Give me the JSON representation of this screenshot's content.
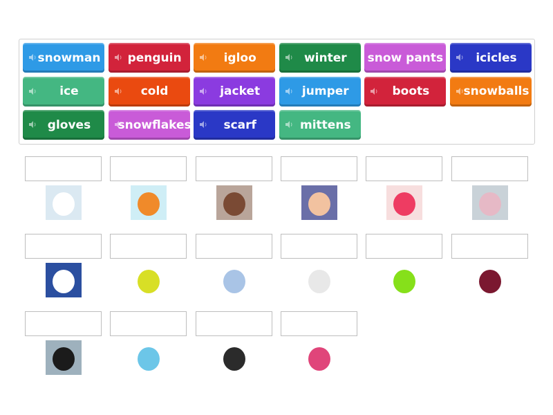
{
  "tiles": [
    {
      "label": "snowman",
      "color": "#2e9ae6",
      "speaker": true
    },
    {
      "label": "penguin",
      "color": "#d2233b",
      "speaker": true
    },
    {
      "label": "igloo",
      "color": "#f27b12",
      "speaker": true
    },
    {
      "label": "winter",
      "color": "#1f8a48",
      "speaker": true
    },
    {
      "label": "snow pants",
      "color": "#c95bd8",
      "speaker": false
    },
    {
      "label": "icicles",
      "color": "#2a38c6",
      "speaker": true
    },
    {
      "label": "ice",
      "color": "#44b782",
      "speaker": true
    },
    {
      "label": "cold",
      "color": "#ea4a10",
      "speaker": true
    },
    {
      "label": "jacket",
      "color": "#8b3be0",
      "speaker": true
    },
    {
      "label": "jumper",
      "color": "#2e9ae6",
      "speaker": true
    },
    {
      "label": "boots",
      "color": "#d2233b",
      "speaker": true
    },
    {
      "label": "snowballs",
      "color": "#f27b12",
      "speaker": true
    },
    {
      "label": "gloves",
      "color": "#1f8a48",
      "speaker": true
    },
    {
      "label": "snowflakes",
      "color": "#c95bd8",
      "speaker": true
    },
    {
      "label": "scarf",
      "color": "#2a38c6",
      "speaker": true
    },
    {
      "label": "mittens",
      "color": "#44b782",
      "speaker": true
    }
  ],
  "targets": [
    {
      "image": "igloo-picture",
      "bg": "#dbe9f2",
      "fg": "#ffffff"
    },
    {
      "image": "cold-figure-picture",
      "bg": "#cfeef6",
      "fg": "#f08a2a"
    },
    {
      "image": "boots-picture",
      "bg": "#b9a59a",
      "fg": "#7a4a34"
    },
    {
      "image": "winter-landscape-picture",
      "bg": "#6a6fa8",
      "fg": "#f2c2a0"
    },
    {
      "image": "mittens-picture",
      "bg": "#f7dede",
      "fg": "#ee3c62"
    },
    {
      "image": "ice-picture",
      "bg": "#c9d2d8",
      "fg": "#e6b9c6"
    },
    {
      "image": "snowman-picture",
      "bg": "#2b4fa0",
      "fg": "#ffffff"
    },
    {
      "image": "snow-pants-picture",
      "bg": "#ffffff",
      "fg": "#d8df26"
    },
    {
      "image": "icicles-picture",
      "bg": "#ffffff",
      "fg": "#a9c4e6"
    },
    {
      "image": "snowballs-picture",
      "bg": "#ffffff",
      "fg": "#e8e8e8"
    },
    {
      "image": "gloves-picture",
      "bg": "#ffffff",
      "fg": "#86e01a"
    },
    {
      "image": "jumper-picture",
      "bg": "#ffffff",
      "fg": "#7b1830"
    },
    {
      "image": "penguin-picture",
      "bg": "#9eb1bd",
      "fg": "#1b1b1b"
    },
    {
      "image": "snowflakes-picture",
      "bg": "#ffffff",
      "fg": "#6cc6e8"
    },
    {
      "image": "jacket-picture",
      "bg": "#ffffff",
      "fg": "#2b2b2b"
    },
    {
      "image": "scarf-picture",
      "bg": "#ffffff",
      "fg": "#e0457a"
    }
  ]
}
